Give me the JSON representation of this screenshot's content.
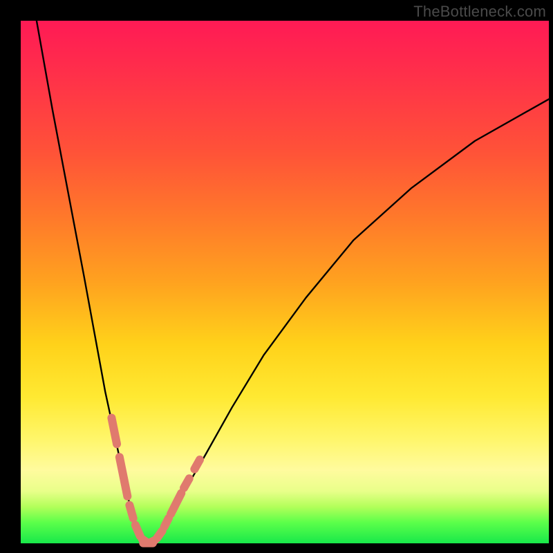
{
  "watermark": "TheBottleneck.com",
  "colors": {
    "curve": "#000000",
    "dash": "#e07a6e",
    "bg_top": "#ff1a55",
    "bg_bottom": "#18e84a",
    "frame": "#000000"
  },
  "chart_data": {
    "type": "line",
    "title": "",
    "xlabel": "",
    "ylabel": "",
    "xlim": [
      0,
      100
    ],
    "ylim": [
      0,
      100
    ],
    "series": [
      {
        "name": "left-branch",
        "x": [
          3,
          6,
          9,
          12,
          14,
          16,
          17.5,
          19,
          20,
          21,
          22,
          23,
          24
        ],
        "y": [
          100,
          83,
          67,
          51,
          40,
          29,
          22,
          15,
          10,
          6,
          3,
          1,
          0
        ]
      },
      {
        "name": "right-branch",
        "x": [
          24,
          26,
          28,
          31,
          35,
          40,
          46,
          54,
          63,
          74,
          86,
          100
        ],
        "y": [
          0,
          2,
          5,
          10,
          17,
          26,
          36,
          47,
          58,
          68,
          77,
          85
        ]
      }
    ],
    "dash_segments_left": [
      {
        "x0": 17.2,
        "y0": 24,
        "x1": 18.2,
        "y1": 19
      },
      {
        "x0": 18.7,
        "y0": 16.5,
        "x1": 20.2,
        "y1": 9
      },
      {
        "x0": 20.6,
        "y0": 7.3,
        "x1": 21.3,
        "y1": 4.8
      },
      {
        "x0": 21.7,
        "y0": 3.5,
        "x1": 22.6,
        "y1": 1.4
      },
      {
        "x0": 23.0,
        "y0": 0.8,
        "x1": 24.0,
        "y1": 0.1
      }
    ],
    "dash_segments_right": [
      {
        "x0": 24.4,
        "y0": 0.1,
        "x1": 25.4,
        "y1": 0.6
      },
      {
        "x0": 25.8,
        "y0": 1.0,
        "x1": 26.8,
        "y1": 2.4
      },
      {
        "x0": 27.2,
        "y0": 3.2,
        "x1": 28.0,
        "y1": 4.8
      },
      {
        "x0": 28.4,
        "y0": 5.6,
        "x1": 30.4,
        "y1": 9.6
      },
      {
        "x0": 30.9,
        "y0": 10.6,
        "x1": 31.9,
        "y1": 12.4
      },
      {
        "x0": 32.9,
        "y0": 14.2,
        "x1": 33.9,
        "y1": 16.0
      }
    ],
    "flat_bottom": {
      "x0": 23.2,
      "x1": 25.0,
      "y": 0.05
    }
  }
}
